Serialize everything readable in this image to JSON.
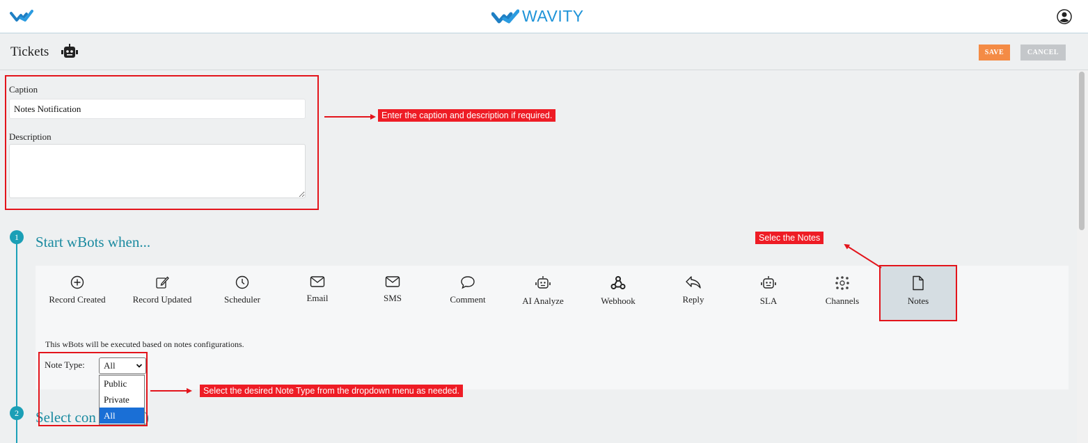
{
  "brand": {
    "name": "WAVITY"
  },
  "header": {
    "title": "Tickets",
    "save_label": "SAVE",
    "cancel_label": "CANCEL"
  },
  "form": {
    "caption_label": "Caption",
    "caption_value": "Notes Notification",
    "description_label": "Description",
    "description_value": ""
  },
  "steps": [
    {
      "number": "1",
      "title": "Start wBots when..."
    },
    {
      "number": "2",
      "title": "Select con"
    }
  ],
  "step2_suffix": ")",
  "triggers": [
    {
      "label": "Record Created",
      "icon": "plus-circle-icon"
    },
    {
      "label": "Record Updated",
      "icon": "edit-icon"
    },
    {
      "label": "Scheduler",
      "icon": "clock-icon"
    },
    {
      "label": "Email",
      "icon": "envelope-icon"
    },
    {
      "label": "SMS",
      "icon": "envelope-icon"
    },
    {
      "label": "Comment",
      "icon": "comment-bubble-icon"
    },
    {
      "label": "AI Analyze",
      "icon": "robot-icon"
    },
    {
      "label": "Webhook",
      "icon": "webhook-icon"
    },
    {
      "label": "Reply",
      "icon": "reply-icon"
    },
    {
      "label": "SLA",
      "icon": "robot-icon"
    },
    {
      "label": "Channels",
      "icon": "channels-icon"
    },
    {
      "label": "Notes",
      "icon": "document-icon",
      "active": true
    }
  ],
  "config": {
    "description": "This wBots will be executed based on notes configurations.",
    "note_type_label": "Note Type:",
    "note_type_value": "All",
    "options": [
      "Public",
      "Private",
      "All"
    ]
  },
  "annotations": {
    "caption_hint": "Enter the caption and description if required.",
    "notes_hint": "Selec the Notes",
    "note_type_hint": "Select the desired Note Type from the dropdown menu as needed."
  },
  "colors": {
    "accent": "#1a8aa0",
    "save": "#f48b45",
    "cancel": "#c4c7ca",
    "annotation": "#ee1c25",
    "brand": "#1e93d8"
  }
}
